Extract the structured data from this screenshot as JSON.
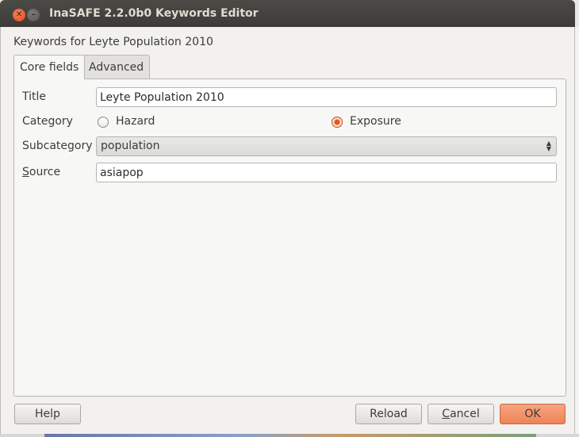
{
  "window": {
    "title": "InaSAFE 2.2.0b0 Keywords Editor",
    "close_glyph": "✕",
    "minimize_glyph": "–"
  },
  "dialog": {
    "heading": "Keywords for Leyte Population 2010",
    "tabs": [
      {
        "label": "Core fields",
        "active": true
      },
      {
        "label": "Advanced",
        "active": false
      }
    ]
  },
  "form": {
    "title_label": "Title",
    "title_value": "Leyte Population 2010",
    "category_label": "Category",
    "category_options": [
      {
        "label": "Hazard",
        "checked": false
      },
      {
        "label": "Exposure",
        "checked": true
      }
    ],
    "subcategory_label": "Subcategory",
    "subcategory_value": "population",
    "source_label_prefix": "S",
    "source_label_rest": "ource",
    "source_value": "asiapop"
  },
  "buttons": {
    "help": "Help",
    "reload": "Reload",
    "cancel_prefix": "C",
    "cancel_rest": "ancel",
    "ok": "OK"
  },
  "colors": {
    "accent": "#ee8357",
    "titlebar": "#3c3b37"
  }
}
